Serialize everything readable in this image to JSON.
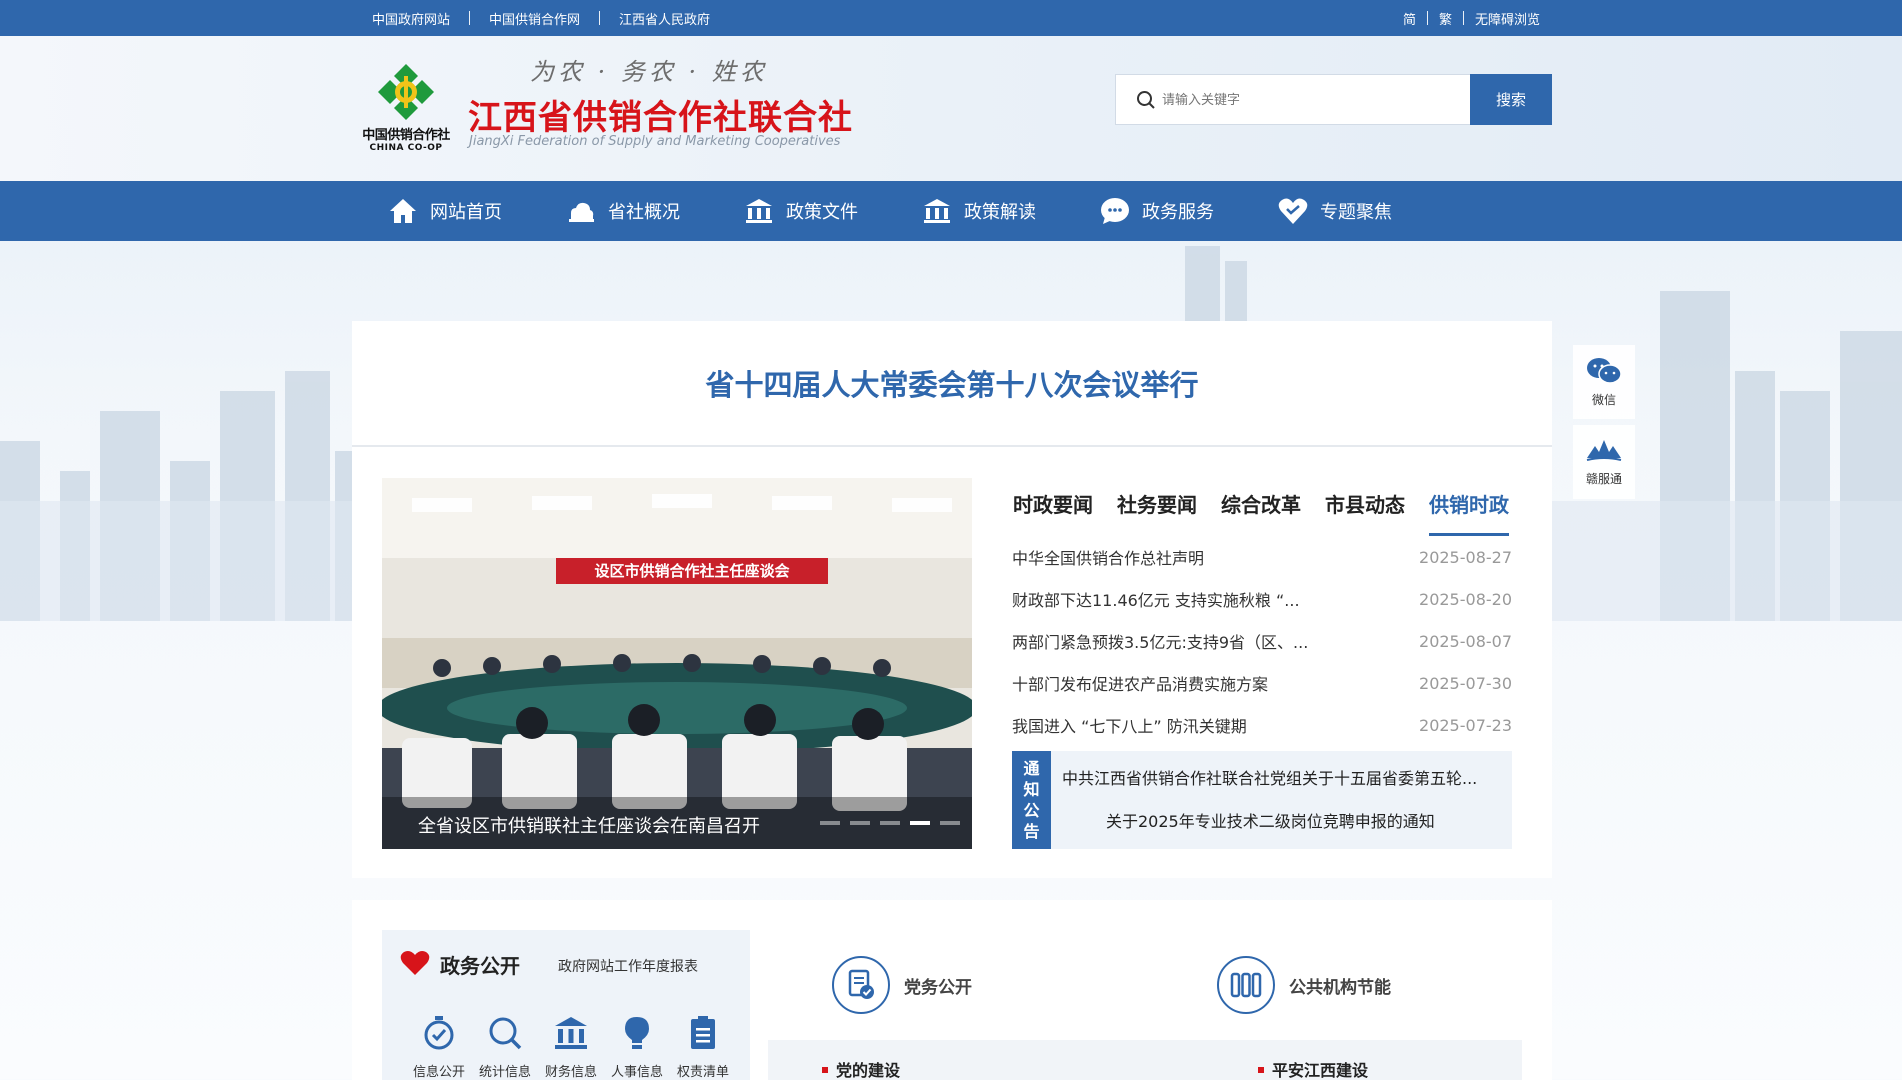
{
  "topbar": {
    "links": [
      "中国政府网站",
      "中国供销合作网",
      "江西省人民政府"
    ],
    "right_links": [
      "简",
      "繁",
      "无障碍浏览"
    ]
  },
  "header": {
    "logo_cn": "中国供销合作社",
    "logo_en": "CHINA CO-OP",
    "slogan": "为农 · 务农 · 姓农",
    "title": "江西省供销合作社联合社",
    "title_en": "JiangXi Federation of Supply and Marketing Cooperatives",
    "search_placeholder": "请输入关键字",
    "search_button": "搜索"
  },
  "nav": {
    "items": [
      {
        "label": "网站首页",
        "icon": "home-icon"
      },
      {
        "label": "省社概况",
        "icon": "cloud-icon"
      },
      {
        "label": "政策文件",
        "icon": "building-icon"
      },
      {
        "label": "政策解读",
        "icon": "building-icon"
      },
      {
        "label": "政务服务",
        "icon": "chat-icon"
      },
      {
        "label": "专题聚焦",
        "icon": "heart-icon"
      }
    ]
  },
  "headline": "省十四届人大常委会第十八次会议举行",
  "carousel": {
    "banner_text": "设区市供销合作社主任座谈会",
    "caption": "全省设区市供销联社主任座谈会在南昌召开",
    "dots": 5,
    "active_dot": 4
  },
  "news": {
    "tabs": [
      "时政要闻",
      "社务要闻",
      "综合改革",
      "市县动态",
      "供销时政"
    ],
    "active_tab": 4,
    "rows": [
      {
        "title": "中华全国供销合作总社声明",
        "date": "2025-08-27"
      },
      {
        "title": "财政部下达11.46亿元 支持实施秋粮 “...",
        "date": "2025-08-20"
      },
      {
        "title": "两部门紧急预拨3.5亿元:支持9省（区、...",
        "date": "2025-08-07"
      },
      {
        "title": "十部门发布促进农产品消费实施方案",
        "date": "2025-07-30"
      },
      {
        "title": "我国进入 “七下八上” 防汛关键期",
        "date": "2025-07-23"
      }
    ]
  },
  "notice": {
    "tag_chars": [
      "通",
      "知",
      "公",
      "告"
    ],
    "items": [
      "中共江西省供销合作社联合社党组关于十五届省委第五轮...",
      "关于2025年专业技术二级岗位竞聘申报的通知"
    ]
  },
  "side": {
    "items": [
      {
        "label": "微信",
        "icon": "wechat-icon"
      },
      {
        "label": "赣服通",
        "icon": "gov-service-icon"
      }
    ]
  },
  "gov": {
    "title": "政务公开",
    "report_link": "政府网站工作年度报表",
    "icons": [
      {
        "label": "信息公开",
        "icon": "stopwatch-icon"
      },
      {
        "label": "统计信息",
        "icon": "search-icon"
      },
      {
        "label": "财务信息",
        "icon": "bank-icon"
      },
      {
        "label": "人事信息",
        "icon": "bulb-icon"
      },
      {
        "label": "权责清单",
        "icon": "clipboard-icon"
      }
    ]
  },
  "categories": [
    {
      "label": "党务公开",
      "icon": "document-check-icon"
    },
    {
      "label": "公共机构节能",
      "icon": "battery-icon"
    }
  ],
  "sub_links": [
    "党的建设",
    "平安江西建设"
  ],
  "colors": {
    "primary": "#2f67ac",
    "brand_red": "#d7141a",
    "logo_green": "#1f9a3c",
    "logo_yellow": "#f0c419"
  }
}
